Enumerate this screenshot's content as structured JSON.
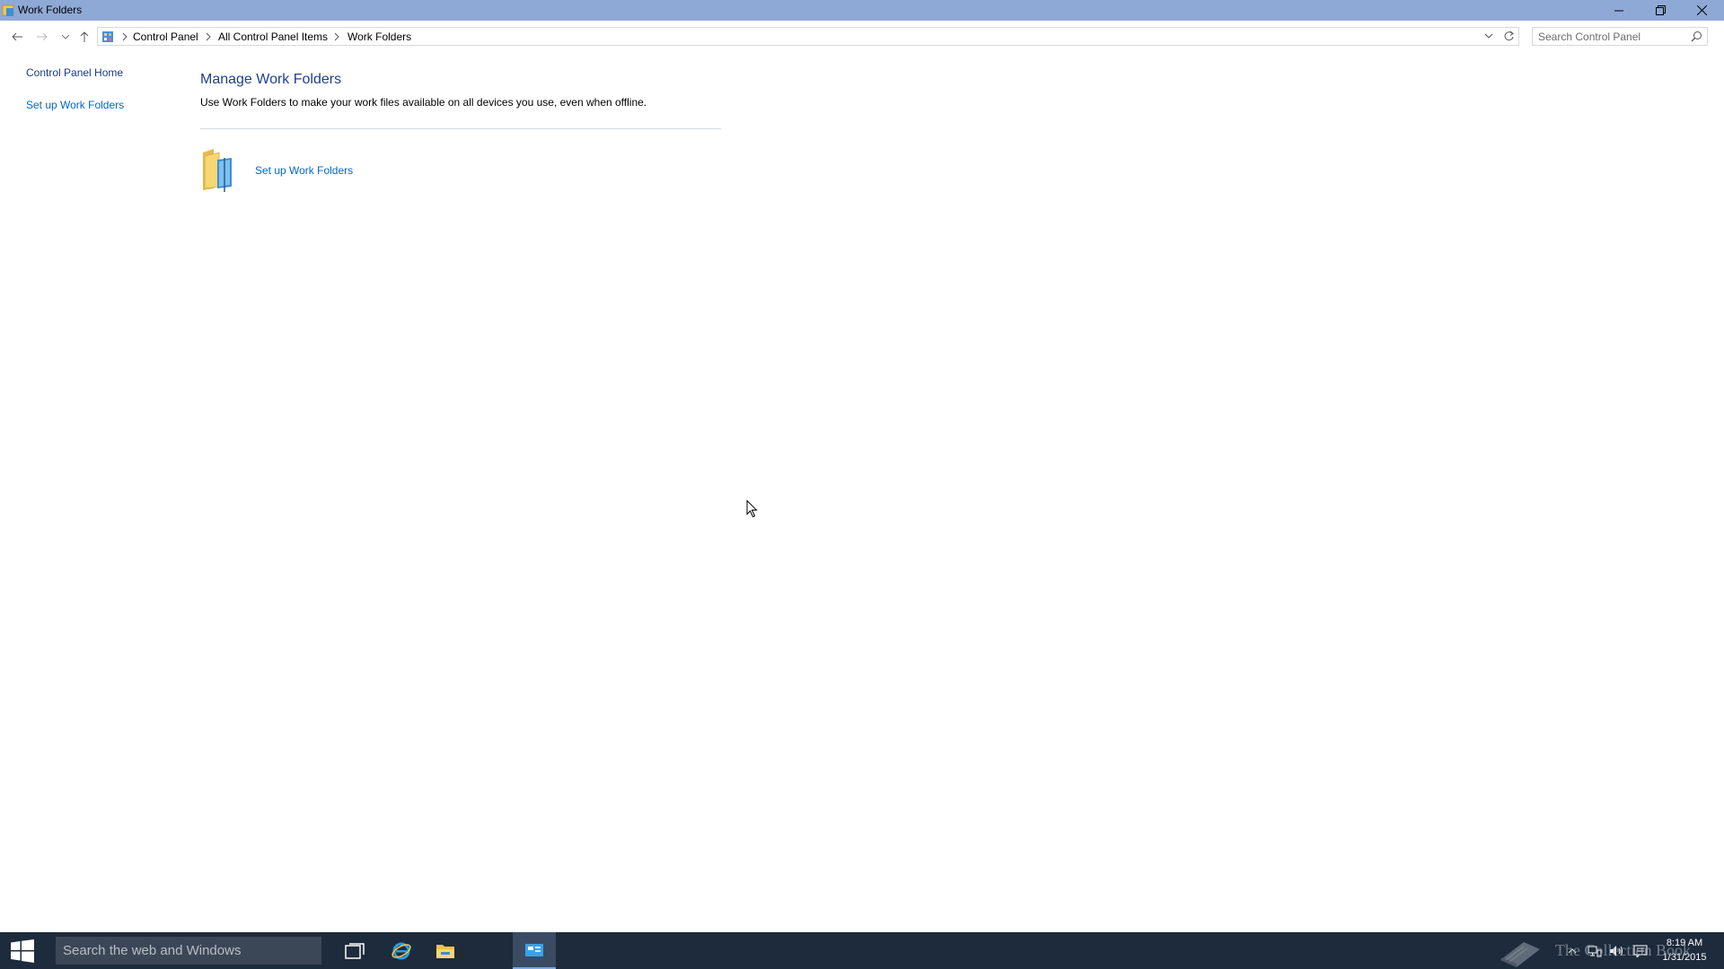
{
  "window": {
    "title": "Work Folders"
  },
  "address_bar": {
    "breadcrumbs": [
      "Control Panel",
      "All Control Panel Items",
      "Work Folders"
    ]
  },
  "search": {
    "placeholder": "Search Control Panel"
  },
  "left_pane": {
    "home_link": "Control Panel Home",
    "setup_link": "Set up Work Folders"
  },
  "main": {
    "title": "Manage Work Folders",
    "description": "Use Work Folders to make your work files available on all devices you use, even when offline.",
    "setup_link": "Set up Work Folders"
  },
  "taskbar": {
    "search_placeholder": "Search the web and Windows",
    "time": "8:19 AM",
    "date": "1/31/2015",
    "apps": [
      "task-view-icon",
      "internet-explorer-icon",
      "file-explorer-icon",
      "control-panel-icon"
    ]
  },
  "watermark": {
    "text": "The Collection Book"
  },
  "colors": {
    "titlebar": "#8fa9d6",
    "link": "#0066cc",
    "heading": "#1e3f8f",
    "taskbar": "#1d2b3c"
  }
}
